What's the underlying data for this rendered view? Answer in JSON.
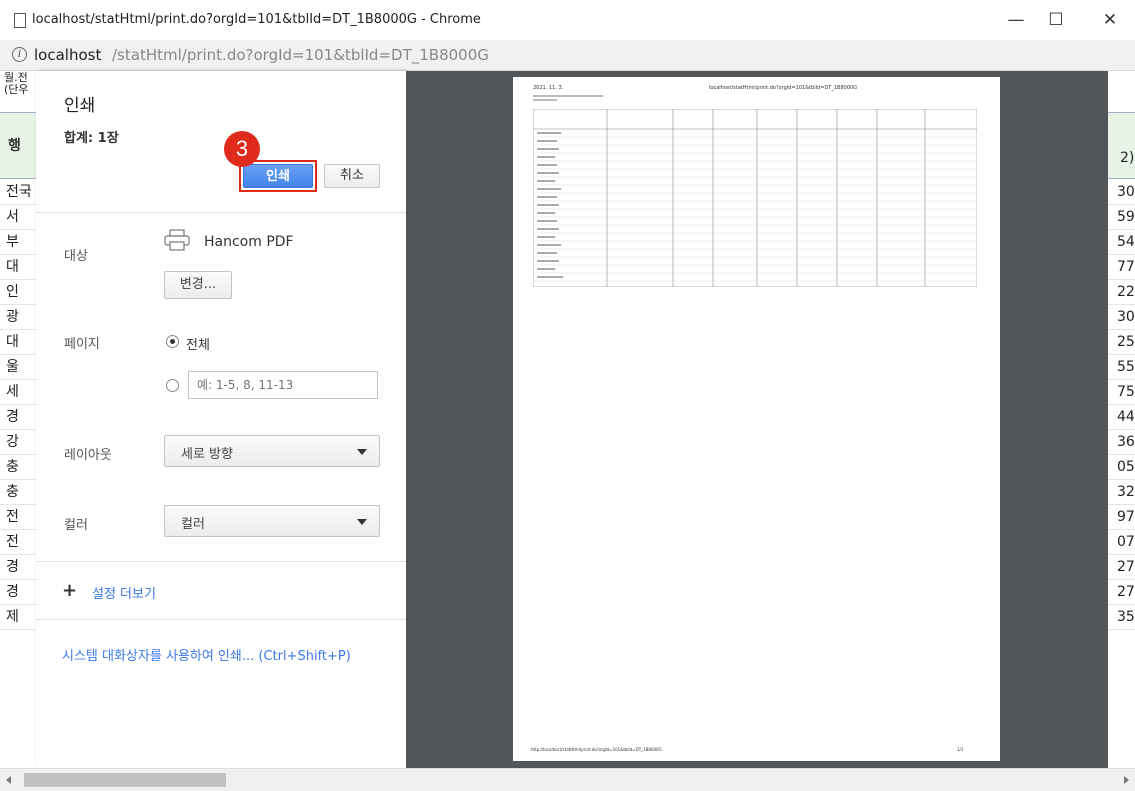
{
  "window": {
    "title": "localhost/statHtml/print.do?orgId=101&tblId=DT_1B8000G - Chrome",
    "minimize": "—",
    "maximize": "☐",
    "close": "✕",
    "address_host": "localhost",
    "address_path": "/statHtml/print.do?orgId=101&tblId=DT_1B8000G",
    "info_icon": "i"
  },
  "background": {
    "top_left_lines": [
      "월.전",
      "(단우"
    ],
    "header_left": "행",
    "header_right": "2)",
    "left_cells": [
      "전국",
      "서",
      "부",
      "대",
      "인",
      "광",
      "대",
      "울",
      "세",
      "경",
      "강",
      "충",
      "충",
      "전",
      "전",
      "경",
      "경",
      "제"
    ],
    "right_cells": [
      "30",
      "59",
      "54",
      "77",
      "22",
      "30",
      "25",
      "55",
      "75",
      "44",
      "36",
      "05",
      "32",
      "97",
      "07",
      "27",
      "27",
      "35"
    ]
  },
  "print_panel": {
    "title": "인쇄",
    "total": "합계: 1장",
    "step_badge": "3",
    "print_button": "인쇄",
    "cancel_button": "취소",
    "destination_label": "대상",
    "printer_name": "Hancom PDF",
    "change_button": "변경...",
    "pages_label": "페이지",
    "pages_all": "전체",
    "pages_placeholder": "예: 1-5, 8, 11-13",
    "layout_label": "레이아웃",
    "layout_value": "세로 방향",
    "color_label": "컬러",
    "color_value": "컬러",
    "more_settings": "설정 더보기",
    "system_dialog": "시스템 대화상자를 사용하여 인쇄... (Ctrl+Shift+P)"
  },
  "preview": {
    "date": "2021. 11. 3.",
    "url": "localhost/statHtml/print.do?orgId=101&tblId=DT_1B8000G",
    "footer_url": "http://localhost/statHtml/print.do?orgId=101&tblId=DT_1B8000G",
    "footer_page": "1/1"
  },
  "colors": {
    "accent_blue": "#4484ec",
    "highlight_red": "#e02a1c",
    "preview_bg": "#525659"
  }
}
